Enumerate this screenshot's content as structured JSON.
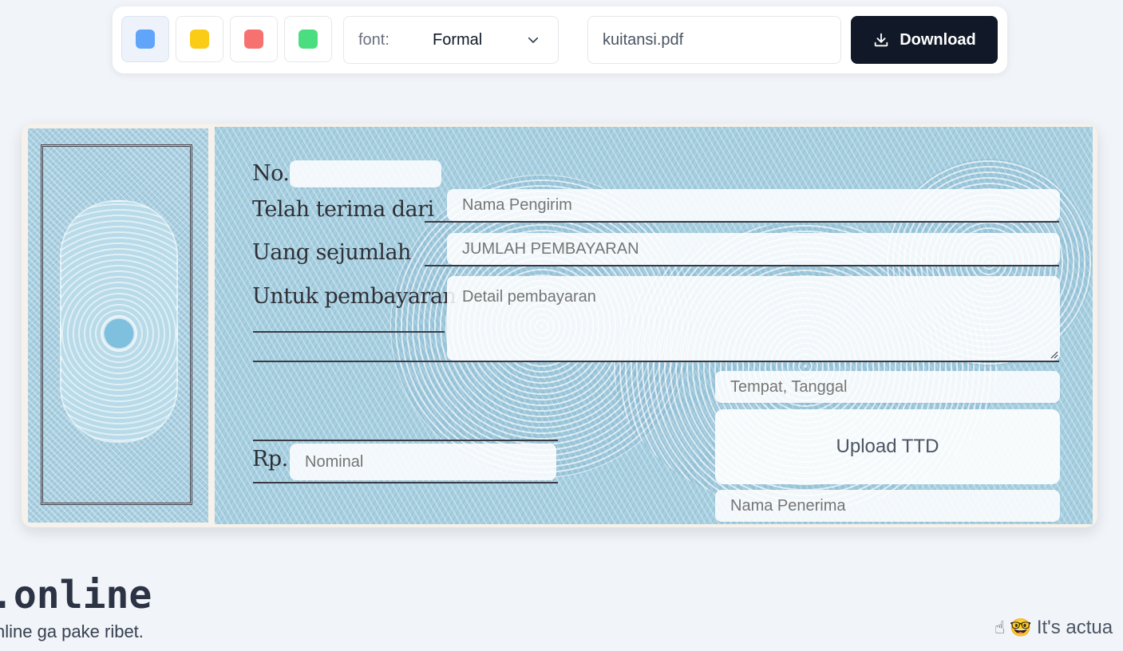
{
  "toolbar": {
    "swatches": [
      {
        "name": "blue",
        "color": "#60a5fa",
        "active": true
      },
      {
        "name": "yellow",
        "color": "#facc15",
        "active": false
      },
      {
        "name": "red",
        "color": "#f87171",
        "active": false
      },
      {
        "name": "green",
        "color": "#4ade80",
        "active": false
      }
    ],
    "font_label": "font:",
    "font_value": "Formal",
    "filename": "kuitansi.pdf",
    "download_label": "Download",
    "download_bg": "#111827"
  },
  "receipt": {
    "labels": {
      "no": "No.",
      "received_from": "Telah terima dari",
      "amount_words": "Uang sejumlah",
      "purpose": "Untuk pembayaran",
      "rp": "Rp."
    },
    "placeholders": {
      "number": "",
      "sender": "Nama Pengirim",
      "amount": "JUMLAH PEMBAYARAN",
      "details": "Detail pembayaran",
      "place_date": "Tempat, Tanggal",
      "nominal": "Nominal",
      "recipient": "Nama Penerima"
    },
    "upload_label": "Upload TTD"
  },
  "footer": {
    "title": ".online",
    "subtitle": "nline ga pake ribet.",
    "note_text": "It's actua"
  }
}
